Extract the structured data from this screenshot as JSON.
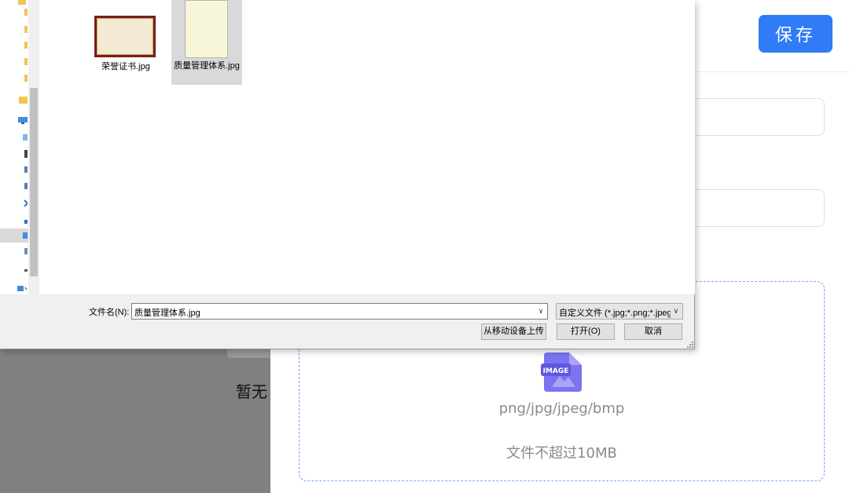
{
  "page": {
    "save_label": "保存",
    "overlay_empty_text": "暂无",
    "upload": {
      "icon": "image-file-icon",
      "icon_badge": "IMAGE",
      "formats": "png/jpg/jpeg/bmp",
      "limit": "文件不超过10MB"
    },
    "colors": {
      "accent": "#2f7cf6",
      "icon": "#7b74f0",
      "overlay": "#808080"
    }
  },
  "dialog": {
    "files": [
      {
        "name": "荣誉证书.jpg",
        "thumbnail": "certificate-thumbnail",
        "selected": false
      },
      {
        "name": "质量管理体系.jpg",
        "thumbnail": "certificate-thumbnail",
        "selected": true
      }
    ],
    "filename_label": "文件名(N):",
    "filename_value": "质量管理体系.jpg",
    "filter_value": "自定义文件 (*.jpg;*.png;*.jpeg",
    "buttons": {
      "mobile_upload": "从移动设备上传",
      "open": "打开(O)",
      "cancel": "取消"
    },
    "dropdown_glyph": "∨"
  }
}
